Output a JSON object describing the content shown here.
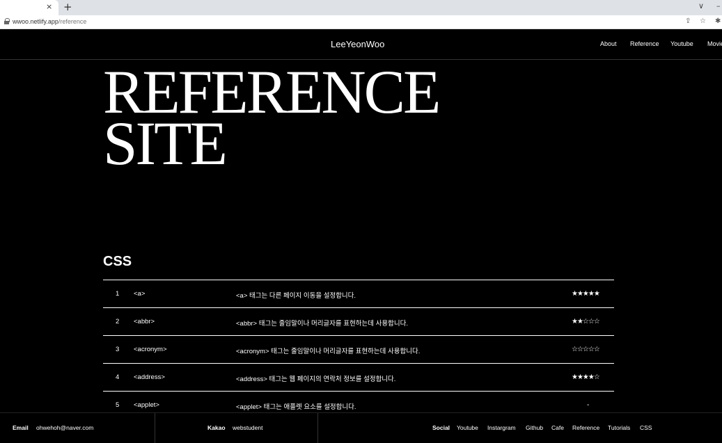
{
  "browser": {
    "tab_close": "×",
    "new_tab": "+",
    "url_host": "wwoo.netlify.app",
    "url_path": "/reference"
  },
  "header": {
    "logo": "LeeYeonWoo",
    "nav": [
      "About",
      "Reference",
      "Youtube",
      "Movie"
    ]
  },
  "hero": {
    "line1": "REFERENCE",
    "line2": "SITE"
  },
  "section": {
    "title": "CSS"
  },
  "rows": [
    {
      "num": "1",
      "tag": "<a>",
      "desc": "<a> 태그는 다른 페이지 이동을 설정합니다.",
      "stars": "★★★★★"
    },
    {
      "num": "2",
      "tag": "<abbr>",
      "desc": "<abbr> 태그는 줄임말이나 머리글자를 표현하는데 사용합니다.",
      "stars": "★★☆☆☆"
    },
    {
      "num": "3",
      "tag": "<acronym>",
      "desc": "<acronym> 태그는 줄임말이나 머리글자를 표현하는데 사용합니다.",
      "stars": "☆☆☆☆☆"
    },
    {
      "num": "4",
      "tag": "<address>",
      "desc": "<address> 태그는 웹 페이지의 연락처 정보를 설정합니다.",
      "stars": "★★★★☆"
    },
    {
      "num": "5",
      "tag": "<applet>",
      "desc": "<applet> 태그는 애플렛 요소를 설정합니다.",
      "stars": "-"
    }
  ],
  "footer": {
    "email_label": "Email",
    "email": "ohwehoh@naver.com",
    "kakao_label": "Kakao",
    "kakao": "webstudent",
    "social_label": "Social",
    "social_links": [
      "Youtube",
      "Instargram",
      "Github",
      "Cafe",
      "Reference",
      "Tutorials",
      "CSS"
    ]
  }
}
